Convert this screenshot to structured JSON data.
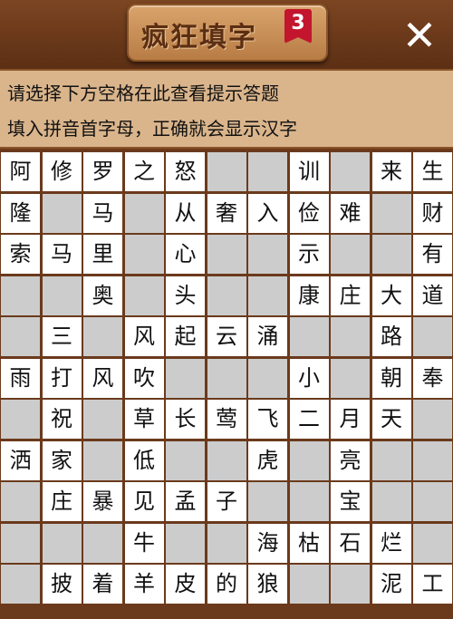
{
  "header": {
    "title": "疯狂填字",
    "level": "3",
    "close_icon": "close-icon"
  },
  "hint": {
    "line1": "请选择下方空格在此查看提示答题",
    "line2": "填入拼音首字母，正确就会显示汉字"
  },
  "colors": {
    "board_background": "#6b3a1c",
    "open_cell": "#ffffff",
    "blocked_cell": "#cccccc",
    "badge": "#c3152d"
  },
  "grid": {
    "columns": 11,
    "rows": 11,
    "cells": [
      [
        "阿",
        "修",
        "罗",
        "之",
        "怒",
        "#",
        "#",
        "训",
        "#",
        "来",
        "生"
      ],
      [
        "隆",
        "#",
        "马",
        "#",
        "从",
        "奢",
        "入",
        "俭",
        "难",
        "#",
        "财"
      ],
      [
        "索",
        "马",
        "里",
        "#",
        "心",
        "#",
        "#",
        "示",
        "#",
        "#",
        "有"
      ],
      [
        "#",
        "#",
        "奥",
        "#",
        "头",
        "#",
        "#",
        "康",
        "庄",
        "大",
        "道"
      ],
      [
        "#",
        "三",
        "#",
        "风",
        "起",
        "云",
        "涌",
        "#",
        "#",
        "路",
        "#"
      ],
      [
        "雨",
        "打",
        "风",
        "吹",
        "#",
        "#",
        "#",
        "小",
        "#",
        "朝",
        "奉"
      ],
      [
        "#",
        "祝",
        "#",
        "草",
        "长",
        "莺",
        "飞",
        "二",
        "月",
        "天",
        "#"
      ],
      [
        "洒",
        "家",
        "#",
        "低",
        "#",
        "#",
        "虎",
        "#",
        "亮",
        "#",
        "#"
      ],
      [
        "#",
        "庄",
        "暴",
        "见",
        "孟",
        "子",
        "#",
        "#",
        "宝",
        "#",
        "#"
      ],
      [
        "#",
        "#",
        "#",
        "牛",
        "#",
        "#",
        "海",
        "枯",
        "石",
        "烂",
        "#"
      ],
      [
        "#",
        "披",
        "着",
        "羊",
        "皮",
        "的",
        "狼",
        "#",
        "#",
        "泥",
        "工"
      ]
    ]
  }
}
